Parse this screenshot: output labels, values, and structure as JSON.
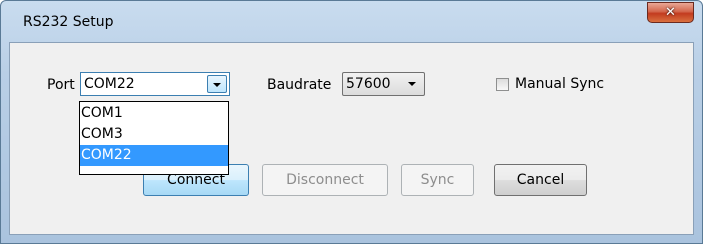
{
  "window": {
    "title": "RS232 Setup",
    "close_symbol": "✕"
  },
  "port": {
    "label": "Port",
    "value": "COM22",
    "options": [
      "COM1",
      "COM3",
      "COM22"
    ],
    "selected_index": 2
  },
  "baudrate": {
    "label": "Baudrate",
    "value": "57600"
  },
  "manual_sync": {
    "label": "Manual Sync",
    "checked": false
  },
  "buttons": {
    "connect": "Connect",
    "disconnect": "Disconnect",
    "sync": "Sync",
    "cancel": "Cancel"
  },
  "colors": {
    "selection": "#3399ff",
    "close_button": "#c23b1f",
    "focus_border": "#3c7fb1"
  }
}
